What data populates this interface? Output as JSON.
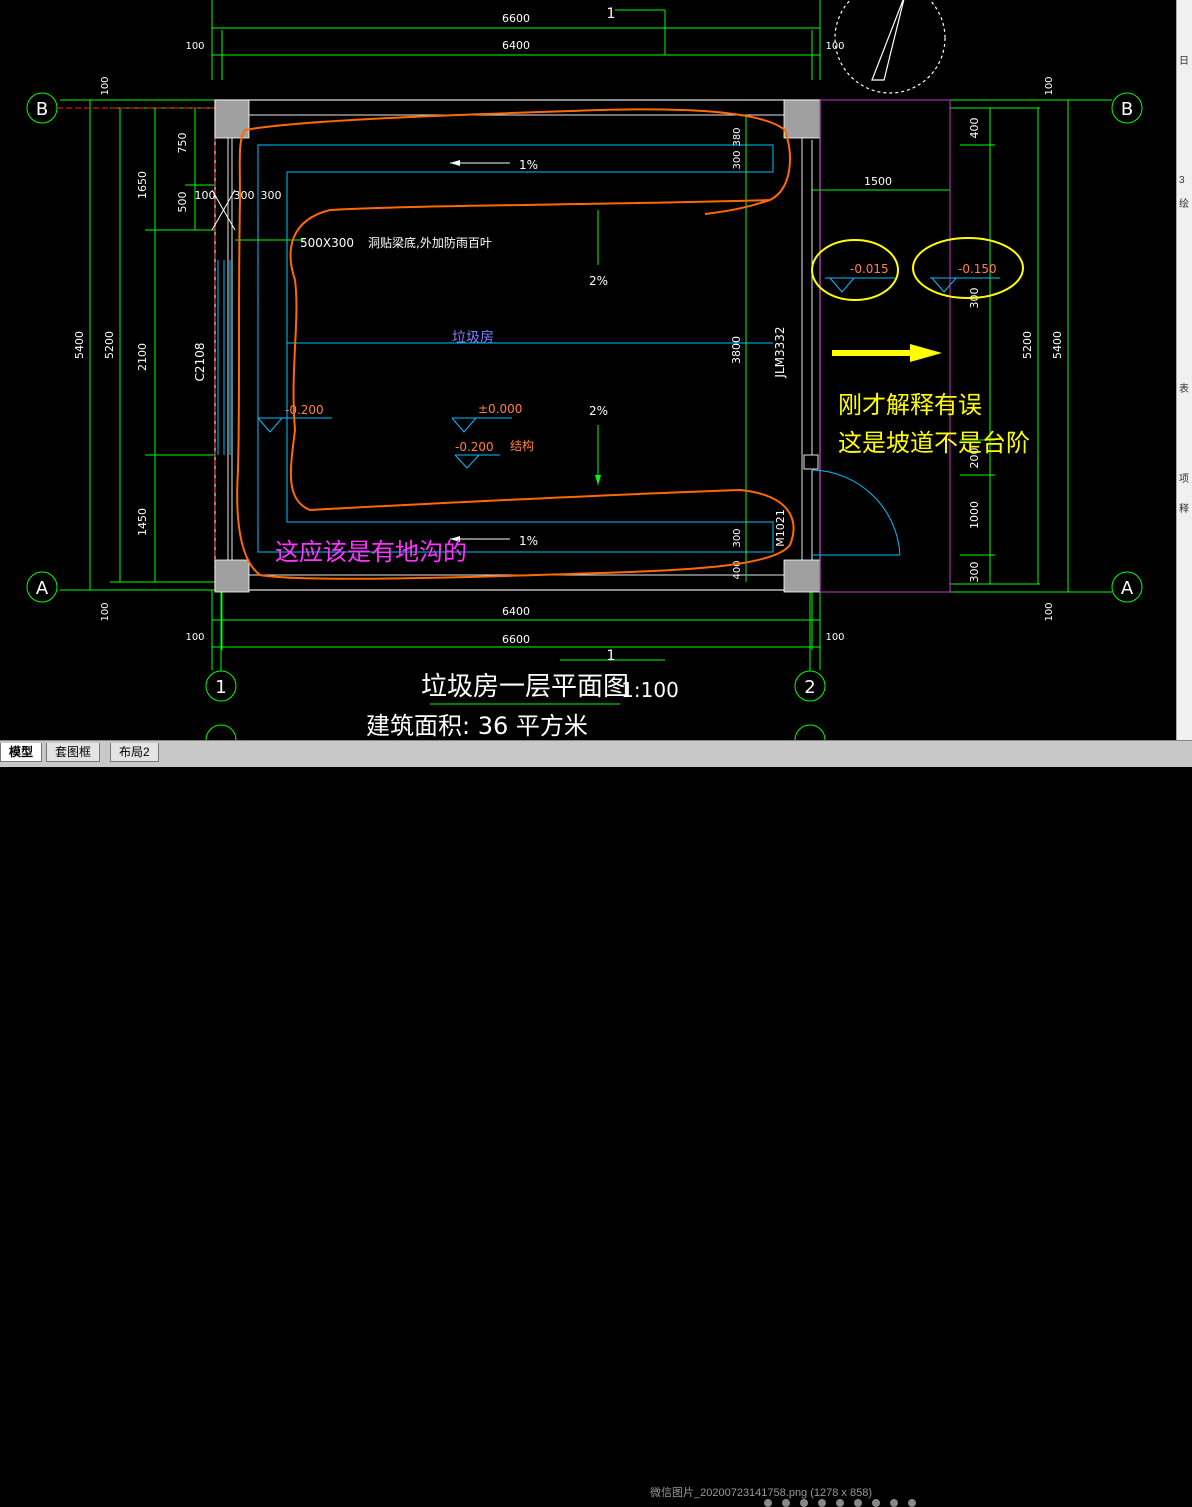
{
  "drawing": {
    "dims": {
      "top_total": "6600",
      "top_inner": "6400",
      "top_left_offset": "100",
      "top_right_offset": "100",
      "bottom_inner": "6400",
      "bottom_total": "6600",
      "bottom_left_offset": "100",
      "bottom_right_offset": "100",
      "top_num": "1",
      "bottom_num": "1",
      "left_5400": "5400",
      "left_5200": "5200",
      "left_1650": "1650",
      "left_2100": "2100",
      "left_1450": "1450",
      "left_750": "750",
      "left_500": "500",
      "left_100_top": "100",
      "left_100_bottom": "100",
      "right_5400": "5400",
      "right_5200": "5200",
      "right_100_top": "100",
      "right_100_bottom": "100",
      "right_400": "400",
      "right_300": "300",
      "right_200": "200",
      "right_1000": "1000",
      "right_300b": "300",
      "ramp_1500": "1500",
      "inner_380": "380",
      "inner_300a": "300",
      "inner_3800": "3800",
      "inner_300b": "300",
      "inner_400": "400",
      "inner_100": "100",
      "inner_300c": "300",
      "inner_300d": "300",
      "door_jlm": "JLM3332",
      "door_m": "M1021",
      "window": "C2108",
      "opening": "500X300",
      "opening_note": "洞贴梁底,外加防雨百叶",
      "slope_1pct_top": "1%",
      "slope_2pct_a": "2%",
      "slope_2pct_b": "2%",
      "slope_1pct_bottom": "1%",
      "room_name": "垃圾房",
      "elev_m0200_left": "-0.200",
      "elev_0": "±0.000",
      "elev_m0200": "-0.200",
      "struct": "结构",
      "elev_m0015": "-0.015",
      "elev_m0150": "-0.150",
      "axis_B": "B",
      "axis_A": "A",
      "axis_1": "1",
      "axis_2": "2",
      "title": "垃圾房一层平面图",
      "scale": "1:100",
      "area": "建筑面积: 36  平方米"
    },
    "annotations": {
      "note_trench": "这应该是有地沟的",
      "note_ramp_line1": "刚才解释有误",
      "note_ramp_line2": "这是坡道不是台阶"
    }
  },
  "tabs": {
    "model": "模型",
    "frame": "套图框",
    "layout2": "布局2"
  },
  "status": {
    "file_label": "微信图片_20200723141758.png (1278 x 858)"
  },
  "right_panel": {
    "items": [
      "日",
      "3",
      "绘",
      "表",
      "项",
      "释"
    ]
  },
  "colors": {
    "background": "#000000",
    "dim_green": "#00ff00",
    "wall_white": "#e6e6e6",
    "cyan": "#00bfff",
    "orange": "#ff6a00",
    "yellow": "#ffff00",
    "magenta": "#ff33ff",
    "red": "#ff2020"
  }
}
